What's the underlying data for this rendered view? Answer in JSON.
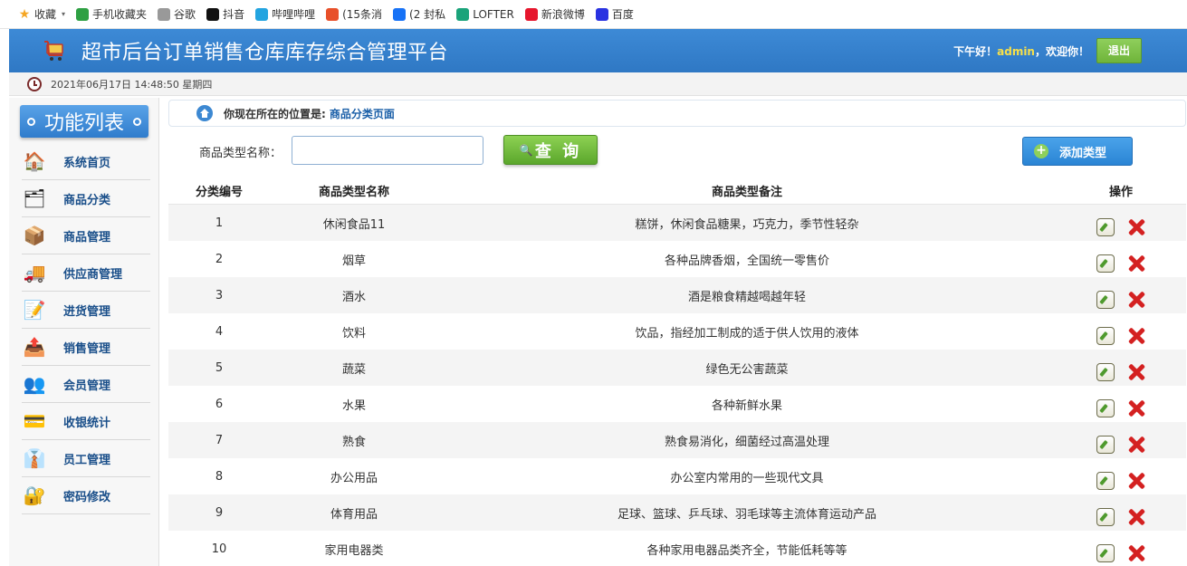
{
  "bookmarks": [
    {
      "label": "收藏",
      "icon": "star-icon",
      "color": "#f5a623"
    },
    {
      "label": "手机收藏夹",
      "icon": "phone-icon",
      "color": "#2ea043"
    },
    {
      "label": "谷歌",
      "icon": "page-icon",
      "color": "#999999"
    },
    {
      "label": "抖音",
      "icon": "tiktok-icon",
      "color": "#111111"
    },
    {
      "label": "哔哩哔哩",
      "icon": "bilibili-icon",
      "color": "#23a4e0"
    },
    {
      "label": "(15条消",
      "icon": "csdn-icon",
      "color": "#e8502a"
    },
    {
      "label": "(2 封私",
      "icon": "zhihu-icon",
      "color": "#1772f6"
    },
    {
      "label": "LOFTER",
      "icon": "lofter-icon",
      "color": "#1aa37a"
    },
    {
      "label": "新浪微博",
      "icon": "weibo-icon",
      "color": "#e6162d"
    },
    {
      "label": "百度",
      "icon": "baidu-icon",
      "color": "#2932e1"
    }
  ],
  "header": {
    "title": "超市后台订单销售仓库库存综合管理平台",
    "greeting_prefix": "下午好！",
    "user": "admin",
    "greeting_suffix": "，欢迎你！",
    "logout_label": "退出"
  },
  "datebar": {
    "datetime": "2021年06月17日 14:48:50 星期四"
  },
  "sidebar": {
    "title": "功能列表",
    "items": [
      {
        "label": "系统首页",
        "icon": "home-icon"
      },
      {
        "label": "商品分类",
        "icon": "category-icon"
      },
      {
        "label": "商品管理",
        "icon": "goods-icon"
      },
      {
        "label": "供应商管理",
        "icon": "supplier-icon"
      },
      {
        "label": "进货管理",
        "icon": "purchase-icon"
      },
      {
        "label": "销售管理",
        "icon": "sales-icon"
      },
      {
        "label": "会员管理",
        "icon": "members-icon"
      },
      {
        "label": "收银统计",
        "icon": "cashier-icon"
      },
      {
        "label": "员工管理",
        "icon": "staff-icon"
      },
      {
        "label": "密码修改",
        "icon": "password-icon"
      }
    ]
  },
  "breadcrumb": {
    "prefix": "你现在所在的位置是:",
    "page": "商品分类页面"
  },
  "search": {
    "label": "商品类型名称：",
    "value": "",
    "placeholder": "",
    "button_label": "查 询"
  },
  "add_button_label": "添加类型",
  "table": {
    "headers": [
      "分类编号",
      "商品类型名称",
      "商品类型备注",
      "操作"
    ],
    "rows": [
      {
        "id": "1",
        "name": "休闲食品11",
        "note": "糕饼，休闲食品糖果，巧克力，季节性轻杂"
      },
      {
        "id": "2",
        "name": "烟草",
        "note": "各种品牌香烟，全国统一零售价"
      },
      {
        "id": "3",
        "name": "酒水",
        "note": "酒是粮食精越喝越年轻"
      },
      {
        "id": "4",
        "name": "饮料",
        "note": "饮品，指经加工制成的适于供人饮用的液体"
      },
      {
        "id": "5",
        "name": "蔬菜",
        "note": "绿色无公害蔬菜"
      },
      {
        "id": "6",
        "name": "水果",
        "note": "各种新鲜水果"
      },
      {
        "id": "7",
        "name": "熟食",
        "note": "熟食易消化，细菌经过高温处理"
      },
      {
        "id": "8",
        "name": "办公用品",
        "note": "办公室内常用的一些现代文具"
      },
      {
        "id": "9",
        "name": "体育用品",
        "note": "足球、篮球、乒乓球、羽毛球等主流体育运动产品"
      },
      {
        "id": "10",
        "name": "家用电器类",
        "note": "各种家用电器品类齐全，节能低耗等等"
      }
    ]
  },
  "colors": {
    "header": "#2f78c4",
    "accent_green": "#6fb43a",
    "accent_blue": "#2a84d4",
    "delete_red": "#d42121",
    "greeting_user": "#f7e04a"
  }
}
